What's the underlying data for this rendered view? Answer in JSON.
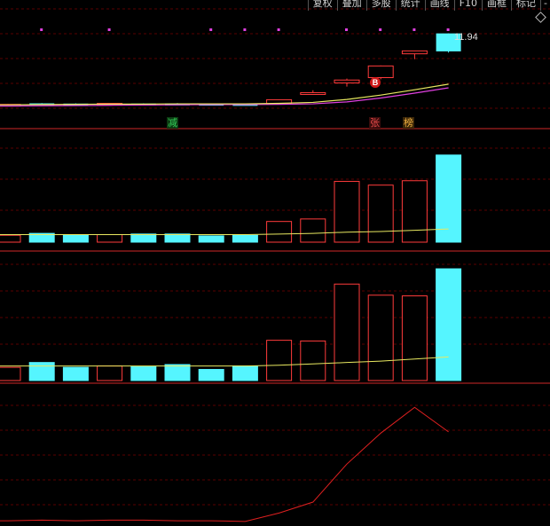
{
  "toolbar": {
    "items": [
      "复权",
      "叠加",
      "多股",
      "统计",
      "画线",
      "F10",
      "画框",
      "标记",
      "-"
    ]
  },
  "price_label": "11.94",
  "tags": {
    "jian": "减",
    "zhang": "张",
    "bang": "榜",
    "b_marker": "B"
  },
  "colors": {
    "background": "#000000",
    "up": "#ff3b3b",
    "down": "#55f5ff",
    "ma_yellow": "#e8e860",
    "ma_magenta": "#e040e0",
    "grid": "#5a0000"
  },
  "chart_data": [
    {
      "type": "candlestick",
      "title": "",
      "candles": [
        {
          "open": 9.02,
          "high": 9.04,
          "low": 8.98,
          "close": 9.0,
          "dir": "up"
        },
        {
          "open": 9.06,
          "high": 9.07,
          "low": 9.03,
          "close": 9.04,
          "dir": "down"
        },
        {
          "open": 9.05,
          "high": 9.06,
          "low": 9.03,
          "close": 9.04,
          "dir": "down"
        },
        {
          "open": 9.05,
          "high": 9.06,
          "low": 9.03,
          "close": 9.06,
          "dir": "up"
        },
        {
          "open": 9.05,
          "high": 9.06,
          "low": 9.03,
          "close": 9.04,
          "dir": "down"
        },
        {
          "open": 9.05,
          "high": 9.07,
          "low": 9.03,
          "close": 9.04,
          "dir": "down"
        },
        {
          "open": 9.04,
          "high": 9.05,
          "low": 9.03,
          "close": 9.03,
          "dir": "down"
        },
        {
          "open": 9.03,
          "high": 9.04,
          "low": 9.02,
          "close": 9.02,
          "dir": "down"
        },
        {
          "open": 9.04,
          "high": 9.22,
          "low": 9.03,
          "close": 9.21,
          "dir": "up"
        },
        {
          "open": 9.5,
          "high": 9.6,
          "low": 9.48,
          "close": 9.5,
          "dir": "up"
        },
        {
          "open": 9.9,
          "high": 10.08,
          "low": 9.75,
          "close": 10.02,
          "dir": "up"
        },
        {
          "open": 10.12,
          "high": 10.62,
          "low": 10.05,
          "close": 10.6,
          "dir": "up"
        },
        {
          "open": 11.1,
          "high": 11.2,
          "low": 10.88,
          "close": 11.22,
          "dir": "up"
        },
        {
          "open": 11.2,
          "high": 11.94,
          "low": 11.15,
          "close": 11.94,
          "dir": "down"
        }
      ],
      "ma_yellow": [
        9.0,
        9.01,
        9.02,
        9.03,
        9.03,
        9.04,
        9.04,
        9.04,
        9.06,
        9.1,
        9.22,
        9.4,
        9.62,
        9.85
      ],
      "ma_magenta": [
        8.95,
        8.96,
        8.97,
        8.98,
        8.99,
        9.0,
        9.01,
        9.01,
        9.02,
        9.04,
        9.12,
        9.28,
        9.48,
        9.7
      ],
      "signal_dots": [
        1,
        3,
        6,
        7,
        8,
        10,
        11,
        12,
        13
      ]
    },
    {
      "type": "bar",
      "title": "",
      "values": [
        11,
        14,
        12,
        12,
        13,
        13,
        10,
        11,
        33,
        37,
        97,
        91,
        98,
        139
      ],
      "directions": [
        "up",
        "down",
        "down",
        "up",
        "down",
        "down",
        "down",
        "down",
        "up",
        "up",
        "up",
        "up",
        "up",
        "down"
      ],
      "ma": [
        12,
        12,
        12,
        12,
        12,
        12,
        12,
        12,
        13,
        14,
        16,
        17,
        19,
        21
      ],
      "ylim": [
        0,
        150
      ]
    },
    {
      "type": "bar",
      "title": "",
      "values": [
        19,
        26,
        19,
        21,
        20,
        23,
        16,
        21,
        58,
        57,
        139,
        123,
        122,
        161
      ],
      "directions": [
        "up",
        "down",
        "down",
        "up",
        "down",
        "down",
        "down",
        "down",
        "up",
        "up",
        "up",
        "up",
        "up",
        "down"
      ],
      "ma": [
        21,
        21,
        21,
        21,
        21,
        21,
        21,
        21,
        22,
        24,
        26,
        28,
        31,
        34
      ],
      "ylim": [
        0,
        170
      ]
    },
    {
      "type": "line",
      "title": "",
      "values": [
        4,
        5,
        4,
        5,
        5,
        4,
        4,
        3,
        16,
        33,
        92,
        140,
        180,
        142
      ],
      "ylim": [
        0,
        190
      ]
    }
  ]
}
